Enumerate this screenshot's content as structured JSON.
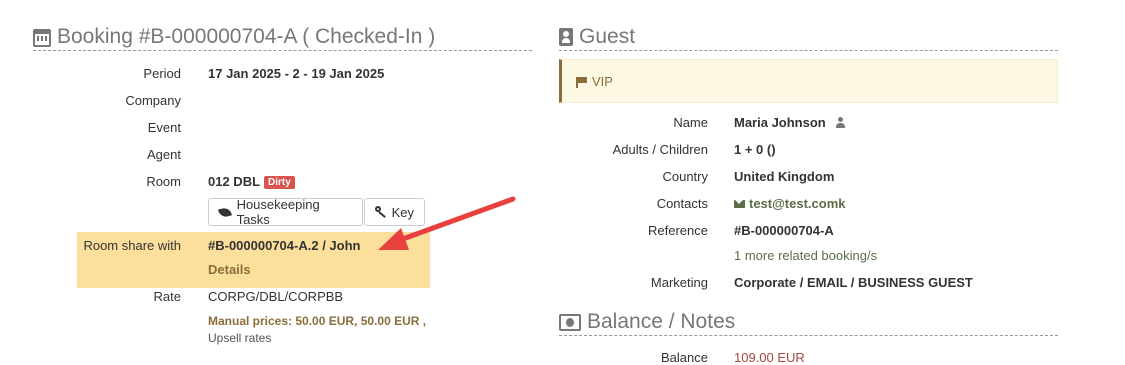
{
  "booking": {
    "title": "Booking #B-000000704-A ( Checked-In )",
    "rows": {
      "period_label": "Period",
      "period_value": "17 Jan 2025 - 2 - 19 Jan 2025",
      "company_label": "Company",
      "event_label": "Event",
      "agent_label": "Agent",
      "room_label": "Room",
      "room_value": "012 DBL",
      "room_status_badge": "Dirty",
      "housekeeping_button": "Housekeeping Tasks",
      "key_button": "Key",
      "room_share_label": "Room share with",
      "room_share_value": "#B-000000704-A.2 / John",
      "room_share_details": "Details",
      "rate_label": "Rate",
      "rate_value": "CORPG/DBL/CORPBB",
      "manual_prices": "Manual prices: 50.00 EUR, 50.00 EUR ,",
      "upsell_rates": "Upsell rates"
    }
  },
  "guest": {
    "title": "Guest",
    "vip_label": "VIP",
    "name_label": "Name",
    "name_value": "Maria Johnson",
    "adults_label": "Adults / Children",
    "adults_value": "1 + 0 ()",
    "country_label": "Country",
    "country_value": "United Kingdom",
    "contacts_label": "Contacts",
    "contacts_value": "test@test.comk",
    "reference_label": "Reference",
    "reference_value": "#B-000000704-A",
    "related_bookings": "1 more related booking/s",
    "marketing_label": "Marketing",
    "marketing_value": "Corporate / EMAIL / BUSINESS GUEST"
  },
  "balance": {
    "title": "Balance / Notes",
    "balance_label": "Balance",
    "balance_value": "109.00 EUR"
  },
  "colors": {
    "highlight": "#fbdf9b",
    "badge_dirty": "#d9534f",
    "link_green": "#5a6e4a",
    "arrow_red": "#e8403f"
  }
}
